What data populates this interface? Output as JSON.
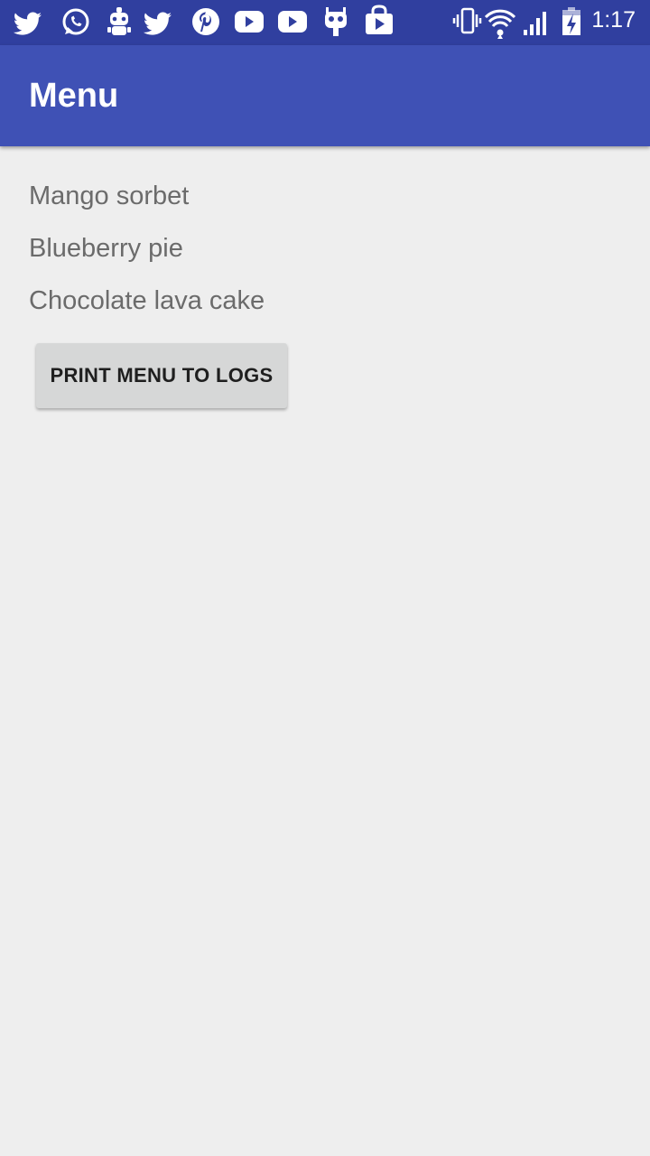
{
  "status_bar": {
    "time": "1:17",
    "left_icons": [
      "twitter-icon",
      "whatsapp-icon",
      "robot-icon",
      "twitter-icon",
      "pinterest-icon",
      "youtube-icon",
      "youtube-icon",
      "cyanogen-icon",
      "play-store-icon"
    ],
    "right_icons": [
      "vibrate-icon",
      "wifi-icon",
      "signal-icon",
      "battery-charging-icon"
    ],
    "bg_color": "#303f9f"
  },
  "app_bar": {
    "title": "Menu",
    "bg_color": "#3f51b5"
  },
  "menu": {
    "items": [
      {
        "label": "Mango sorbet"
      },
      {
        "label": "Blueberry pie"
      },
      {
        "label": "Chocolate lava cake"
      }
    ]
  },
  "actions": {
    "print_label": "PRINT MENU TO LOGS"
  }
}
